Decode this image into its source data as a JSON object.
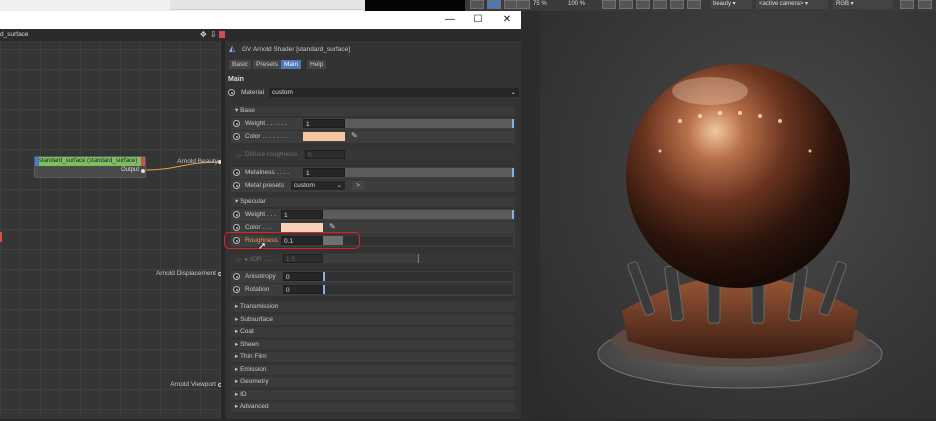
{
  "topbar": {
    "zoom1": "75 %",
    "zoom2": "100 %",
    "display_pass": "beauty",
    "camera": "<active camera>",
    "color_space": "RGB"
  },
  "window": {
    "minimize": "—",
    "maximize": "☐",
    "close": "✕"
  },
  "node_editor": {
    "header": "d_surface",
    "node_title": "standard_surface (standard_surface)",
    "node_output": "Output",
    "labels": [
      "Arnold Beauty",
      "Arnold Displacement",
      "Arnold Viewport"
    ]
  },
  "attr": {
    "title": "GV Arnold Shader [standard_surface]",
    "tabs": [
      "Basic",
      "Presets",
      "Main",
      "Help"
    ],
    "active_tab": "Main",
    "section_main": "Main",
    "material_label": "Material",
    "material_value": "custom",
    "base": {
      "header": "▾ Base",
      "weight_label": "Weight . . . . . .",
      "weight_value": "1",
      "color_label": "Color . . . . . . .",
      "color": "#f6c6a4",
      "diffuse_roughness_label": "Diffuse roughness",
      "diffuse_roughness_value": "0",
      "metalness_label": "Metalness . . . .",
      "metalness_value": "1",
      "metal_presets_label": "Metal presets",
      "metal_presets_value": "custom",
      "metal_presets_button": ">"
    },
    "specular": {
      "header": "▾ Specular",
      "weight_label": "Weight . . .",
      "weight_value": "1",
      "color_label": "Color . . .",
      "color": "#fbd0b8",
      "roughness_label": "Roughness",
      "roughness_value": "0.1",
      "ior_label": "▸ IOR . . . . .",
      "ior_value": "1.5",
      "anisotropy_label": "Anisotropy",
      "anisotropy_value": "0",
      "rotation_label": "Rotation",
      "rotation_value": "0"
    },
    "collapsed_sections": [
      "Transmission",
      "Subsurface",
      "Coat",
      "Sheen",
      "Thin Film",
      "Emission",
      "Geometry",
      "ID",
      "Advanced"
    ]
  },
  "colors": {
    "accent": "#4f78b8",
    "highlight": "#dd2222",
    "node_title": "#7fbf62"
  }
}
